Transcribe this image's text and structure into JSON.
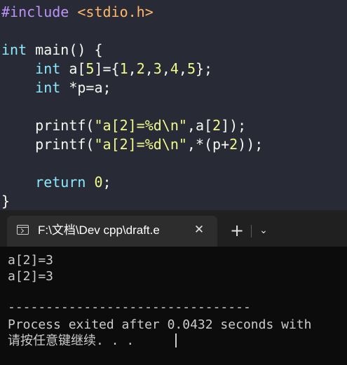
{
  "editor": {
    "lines": [
      [
        {
          "t": "#include ",
          "c": "dir"
        },
        {
          "t": "<stdio.h>",
          "c": "hdr"
        }
      ],
      [],
      [
        {
          "t": "int",
          "c": "kw"
        },
        {
          "t": " main() {",
          "c": "txt"
        }
      ],
      [
        {
          "t": "    ",
          "c": "txt"
        },
        {
          "t": "int",
          "c": "kw"
        },
        {
          "t": " a[",
          "c": "txt"
        },
        {
          "t": "5",
          "c": "num"
        },
        {
          "t": "]={",
          "c": "txt"
        },
        {
          "t": "1",
          "c": "num"
        },
        {
          "t": ",",
          "c": "txt"
        },
        {
          "t": "2",
          "c": "num"
        },
        {
          "t": ",",
          "c": "txt"
        },
        {
          "t": "3",
          "c": "num"
        },
        {
          "t": ",",
          "c": "txt"
        },
        {
          "t": "4",
          "c": "num"
        },
        {
          "t": ",",
          "c": "txt"
        },
        {
          "t": "5",
          "c": "num"
        },
        {
          "t": "};",
          "c": "txt"
        }
      ],
      [
        {
          "t": "    ",
          "c": "txt"
        },
        {
          "t": "int",
          "c": "kw"
        },
        {
          "t": " *p=a;",
          "c": "txt"
        }
      ],
      [],
      [
        {
          "t": "    printf(",
          "c": "txt"
        },
        {
          "t": "\"a[2]=%d\\n\"",
          "c": "str"
        },
        {
          "t": ",a[",
          "c": "txt"
        },
        {
          "t": "2",
          "c": "num"
        },
        {
          "t": "]);",
          "c": "txt"
        }
      ],
      [
        {
          "t": "    printf(",
          "c": "txt"
        },
        {
          "t": "\"a[2]=%d\\n\"",
          "c": "str"
        },
        {
          "t": ",*(p+",
          "c": "txt"
        },
        {
          "t": "2",
          "c": "num"
        },
        {
          "t": "));",
          "c": "txt"
        }
      ],
      [],
      [
        {
          "t": "    ",
          "c": "txt"
        },
        {
          "t": "return",
          "c": "kw"
        },
        {
          "t": " ",
          "c": "txt"
        },
        {
          "t": "0",
          "c": "num"
        },
        {
          "t": ";",
          "c": "txt"
        }
      ],
      [
        {
          "t": "}",
          "c": "txt"
        }
      ]
    ]
  },
  "terminal": {
    "tab_title": "F:\\文档\\Dev cpp\\draft.e",
    "close_symbol": "✕",
    "new_tab_symbol": "+",
    "dropdown_symbol": "⌄",
    "output": [
      "a[2]=3",
      "a[2]=3",
      "",
      "--------------------------------",
      "Process exited after 0.0432 seconds with",
      "请按任意键继续. . ."
    ]
  },
  "colors": {
    "editor_bg": "#282a36",
    "keyword": "#8be9fd",
    "number": "#f1fa8c",
    "string": "#f1fa8c",
    "directive": "#bd93f9",
    "terminal_bg": "#0c0c0c"
  },
  "icons": {
    "tab_icon": "terminal-icon"
  }
}
